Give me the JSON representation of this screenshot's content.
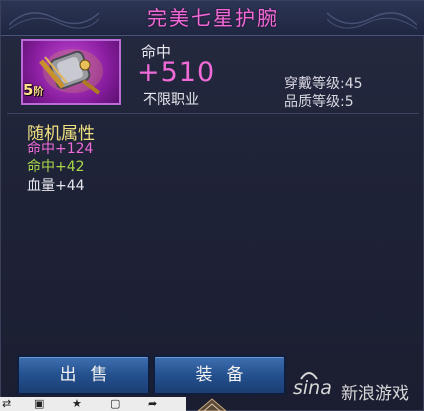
{
  "item": {
    "title": "完美七星护腕",
    "tier_number": "5",
    "tier_unit": "阶",
    "stat_name": "命中",
    "stat_value": "+510",
    "job_restriction": "不限职业",
    "wear_level": "穿戴等级:45",
    "quality_level": "品质等级:5"
  },
  "random_attributes": {
    "title": "随机属性",
    "lines": [
      "命中+124",
      "命中+42",
      "血量+44"
    ]
  },
  "buttons": {
    "sell": "出售",
    "equip": "装备"
  },
  "watermark": {
    "logo": "sina",
    "text": "新浪游戏"
  },
  "colors": {
    "title_pink": "#f06ad8",
    "attr_header_yellow": "#f0e080",
    "attr_green": "#a8d84a",
    "button_blue": "#24508e"
  }
}
